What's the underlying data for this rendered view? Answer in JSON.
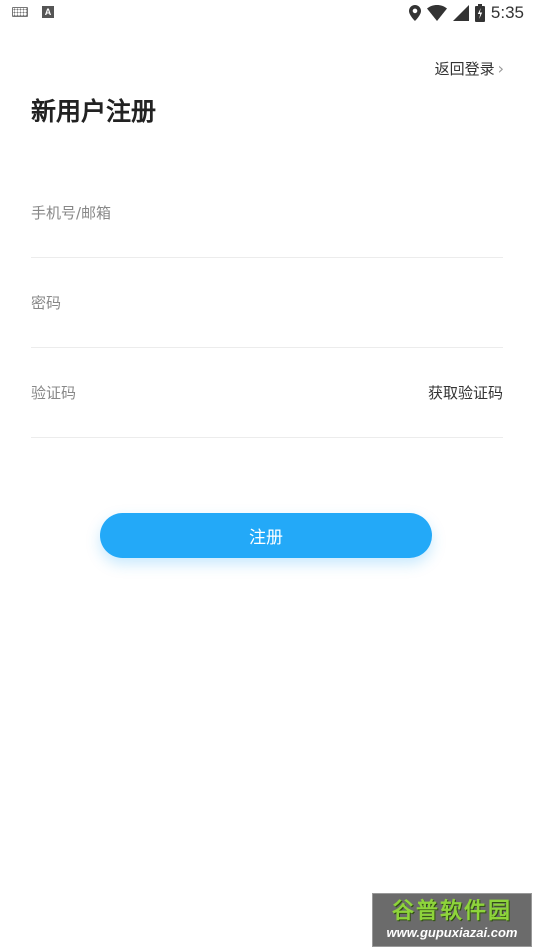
{
  "status_bar": {
    "time": "5:35",
    "icons": [
      "keyboard-icon",
      "a-icon",
      "location-icon",
      "wifi-icon",
      "signal-icon",
      "battery-icon"
    ],
    "app_badge_letter": "A"
  },
  "header": {
    "back_login_label": "返回登录",
    "chevron": "›"
  },
  "title": "新用户注册",
  "form": {
    "phone_placeholder": "手机号/邮箱",
    "password_placeholder": "密码",
    "code_placeholder": "验证码",
    "get_code_label": "获取验证码"
  },
  "register_button": "注册",
  "watermark": {
    "title": "谷普软件园",
    "url": "www.gupuxiazai.com"
  },
  "colors": {
    "accent": "#23a9f8",
    "divider": "#ececec",
    "placeholder": "#888888"
  }
}
